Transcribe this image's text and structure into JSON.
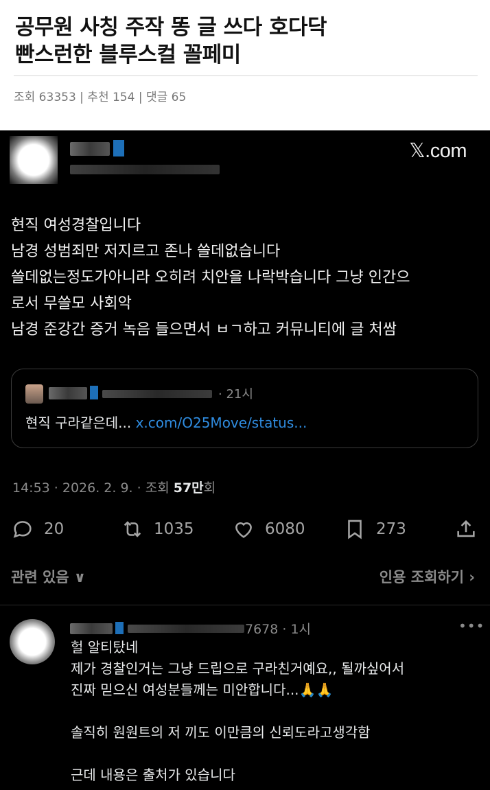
{
  "post": {
    "title_line1": "공무원 사칭 주작 똥 글 쓰다 호다닥",
    "title_line2": "빤스런한 블루스컬 꼴페미",
    "meta": "조회 63353 | 추천 154 | 댓글 65"
  },
  "tweet": {
    "brand": "𝕏.com",
    "lines": [
      "현직 여성경찰입니다",
      "남경 성범죄만 저지르고 존나 쓸데없습니다",
      "쓸데없는정도가아니라 오히려 치안을 나락박습니다 그냥 인간으",
      "로서 무쓸모 사회악",
      "남경 준강간 증거 녹음 들으면서 ㅂㄱ하고 커뮤니티에 글 처쌈"
    ],
    "quoted": {
      "time": "· 21시",
      "text": "현직 구라같은데... ",
      "link": "x.com/O25Move/status..."
    },
    "timestamp": "14:53 · 2026. 2. 9. · 조회 ",
    "views": "57만",
    "views_suffix": "회",
    "actions": {
      "replies": "20",
      "reposts": "1035",
      "likes": "6080",
      "bookmarks": "273"
    },
    "related": "관련 있음",
    "quotes_view": "인용 조회하기"
  },
  "reply": {
    "meta": "7678 · 1시",
    "more": "•••",
    "lines": [
      "헐 알티탔네",
      "제가 경찰인거는 그냥 드립으로 구라친거예요,, 될까싶어서",
      "진짜 믿으신 여성분들께는 미안합니다...🙏🙏",
      "",
      "솔직히 원원트의 저 끼도 이만큼의 신뢰도라고생각함",
      "",
      "근데 내용은 출처가 있습니다"
    ]
  }
}
